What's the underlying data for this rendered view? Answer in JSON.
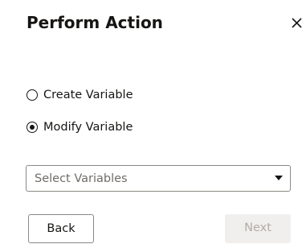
{
  "dialog": {
    "title": "Perform Action",
    "close_icon": "close-icon"
  },
  "options": [
    {
      "label": "Create Variable",
      "checked": false
    },
    {
      "label": "Modify Variable",
      "checked": true
    }
  ],
  "select": {
    "placeholder": "Select Variables",
    "icon": "chevron-down-icon"
  },
  "buttons": {
    "back_label": "Back",
    "next_label": "Next",
    "next_enabled": false
  }
}
